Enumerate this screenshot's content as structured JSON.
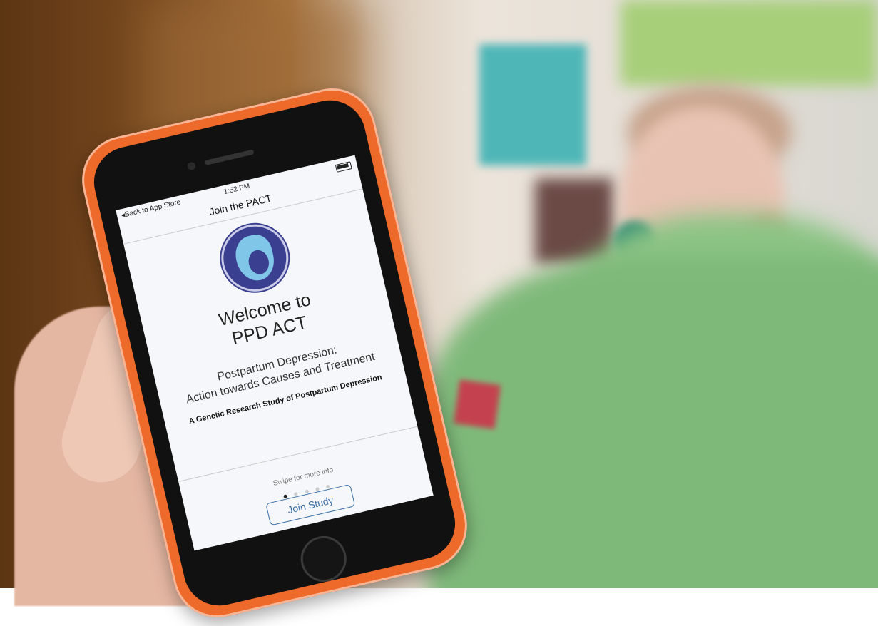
{
  "status_bar": {
    "back_label": "◂Back to App Store",
    "time": "1:52 PM"
  },
  "nav": {
    "title": "Join the PACT"
  },
  "welcome": {
    "line1": "Welcome to",
    "line2": "PPD ACT"
  },
  "subtitle": {
    "line1": "Postpartum Depression:",
    "line2": "Action towards Causes and Treatment"
  },
  "study_description": "A Genetic Research Study of Postpartum Depression",
  "swipe_hint": "Swipe for more info",
  "pager": {
    "pages": 5,
    "current_page": 1
  },
  "join_button": {
    "label": "Join Study"
  },
  "colors": {
    "case": "#ee6a2a",
    "logo_bg": "#3a3f8f",
    "logo_face": "#7fc6e8",
    "button": "#3a6ea5"
  },
  "icons": [
    "back-chevron-icon",
    "bluetooth-icon",
    "battery-icon",
    "pact-logo"
  ]
}
